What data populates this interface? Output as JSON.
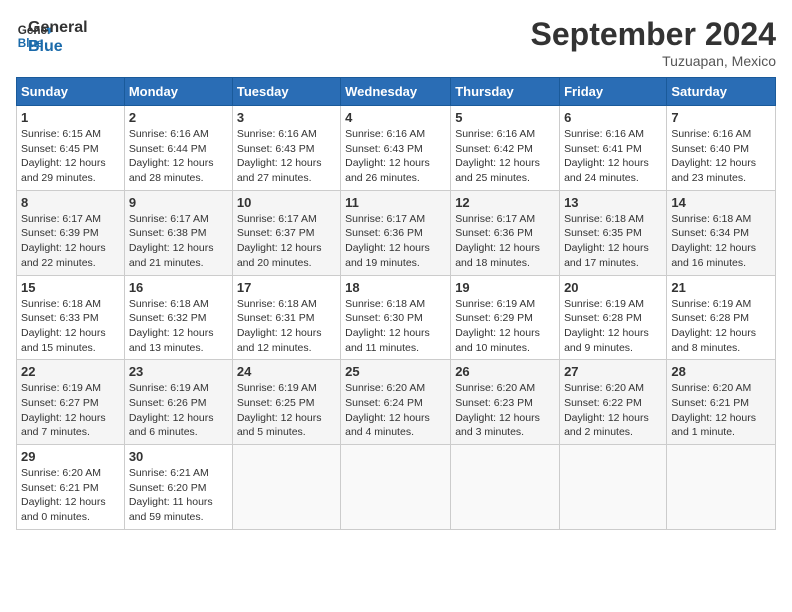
{
  "logo": {
    "text_general": "General",
    "text_blue": "Blue"
  },
  "title": "September 2024",
  "subtitle": "Tuzuapan, Mexico",
  "days_of_week": [
    "Sunday",
    "Monday",
    "Tuesday",
    "Wednesday",
    "Thursday",
    "Friday",
    "Saturday"
  ],
  "weeks": [
    [
      {
        "day": "1",
        "info": "Sunrise: 6:15 AM\nSunset: 6:45 PM\nDaylight: 12 hours\nand 29 minutes."
      },
      {
        "day": "2",
        "info": "Sunrise: 6:16 AM\nSunset: 6:44 PM\nDaylight: 12 hours\nand 28 minutes."
      },
      {
        "day": "3",
        "info": "Sunrise: 6:16 AM\nSunset: 6:43 PM\nDaylight: 12 hours\nand 27 minutes."
      },
      {
        "day": "4",
        "info": "Sunrise: 6:16 AM\nSunset: 6:43 PM\nDaylight: 12 hours\nand 26 minutes."
      },
      {
        "day": "5",
        "info": "Sunrise: 6:16 AM\nSunset: 6:42 PM\nDaylight: 12 hours\nand 25 minutes."
      },
      {
        "day": "6",
        "info": "Sunrise: 6:16 AM\nSunset: 6:41 PM\nDaylight: 12 hours\nand 24 minutes."
      },
      {
        "day": "7",
        "info": "Sunrise: 6:16 AM\nSunset: 6:40 PM\nDaylight: 12 hours\nand 23 minutes."
      }
    ],
    [
      {
        "day": "8",
        "info": "Sunrise: 6:17 AM\nSunset: 6:39 PM\nDaylight: 12 hours\nand 22 minutes."
      },
      {
        "day": "9",
        "info": "Sunrise: 6:17 AM\nSunset: 6:38 PM\nDaylight: 12 hours\nand 21 minutes."
      },
      {
        "day": "10",
        "info": "Sunrise: 6:17 AM\nSunset: 6:37 PM\nDaylight: 12 hours\nand 20 minutes."
      },
      {
        "day": "11",
        "info": "Sunrise: 6:17 AM\nSunset: 6:36 PM\nDaylight: 12 hours\nand 19 minutes."
      },
      {
        "day": "12",
        "info": "Sunrise: 6:17 AM\nSunset: 6:36 PM\nDaylight: 12 hours\nand 18 minutes."
      },
      {
        "day": "13",
        "info": "Sunrise: 6:18 AM\nSunset: 6:35 PM\nDaylight: 12 hours\nand 17 minutes."
      },
      {
        "day": "14",
        "info": "Sunrise: 6:18 AM\nSunset: 6:34 PM\nDaylight: 12 hours\nand 16 minutes."
      }
    ],
    [
      {
        "day": "15",
        "info": "Sunrise: 6:18 AM\nSunset: 6:33 PM\nDaylight: 12 hours\nand 15 minutes."
      },
      {
        "day": "16",
        "info": "Sunrise: 6:18 AM\nSunset: 6:32 PM\nDaylight: 12 hours\nand 13 minutes."
      },
      {
        "day": "17",
        "info": "Sunrise: 6:18 AM\nSunset: 6:31 PM\nDaylight: 12 hours\nand 12 minutes."
      },
      {
        "day": "18",
        "info": "Sunrise: 6:18 AM\nSunset: 6:30 PM\nDaylight: 12 hours\nand 11 minutes."
      },
      {
        "day": "19",
        "info": "Sunrise: 6:19 AM\nSunset: 6:29 PM\nDaylight: 12 hours\nand 10 minutes."
      },
      {
        "day": "20",
        "info": "Sunrise: 6:19 AM\nSunset: 6:28 PM\nDaylight: 12 hours\nand 9 minutes."
      },
      {
        "day": "21",
        "info": "Sunrise: 6:19 AM\nSunset: 6:28 PM\nDaylight: 12 hours\nand 8 minutes."
      }
    ],
    [
      {
        "day": "22",
        "info": "Sunrise: 6:19 AM\nSunset: 6:27 PM\nDaylight: 12 hours\nand 7 minutes."
      },
      {
        "day": "23",
        "info": "Sunrise: 6:19 AM\nSunset: 6:26 PM\nDaylight: 12 hours\nand 6 minutes."
      },
      {
        "day": "24",
        "info": "Sunrise: 6:19 AM\nSunset: 6:25 PM\nDaylight: 12 hours\nand 5 minutes."
      },
      {
        "day": "25",
        "info": "Sunrise: 6:20 AM\nSunset: 6:24 PM\nDaylight: 12 hours\nand 4 minutes."
      },
      {
        "day": "26",
        "info": "Sunrise: 6:20 AM\nSunset: 6:23 PM\nDaylight: 12 hours\nand 3 minutes."
      },
      {
        "day": "27",
        "info": "Sunrise: 6:20 AM\nSunset: 6:22 PM\nDaylight: 12 hours\nand 2 minutes."
      },
      {
        "day": "28",
        "info": "Sunrise: 6:20 AM\nSunset: 6:21 PM\nDaylight: 12 hours\nand 1 minute."
      }
    ],
    [
      {
        "day": "29",
        "info": "Sunrise: 6:20 AM\nSunset: 6:21 PM\nDaylight: 12 hours\nand 0 minutes."
      },
      {
        "day": "30",
        "info": "Sunrise: 6:21 AM\nSunset: 6:20 PM\nDaylight: 11 hours\nand 59 minutes."
      },
      {
        "day": "",
        "info": ""
      },
      {
        "day": "",
        "info": ""
      },
      {
        "day": "",
        "info": ""
      },
      {
        "day": "",
        "info": ""
      },
      {
        "day": "",
        "info": ""
      }
    ]
  ]
}
